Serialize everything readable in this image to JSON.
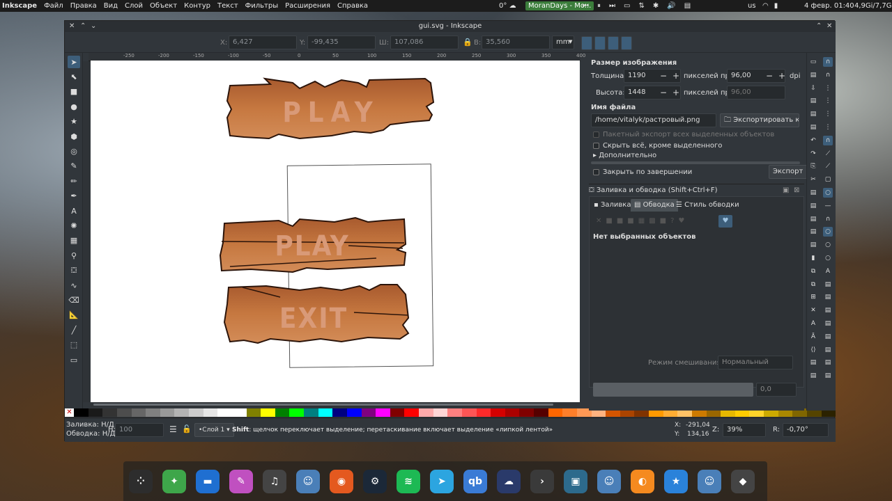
{
  "topbar": {
    "app": "Inkscape",
    "menu": [
      "Файл",
      "Правка",
      "Вид",
      "Слой",
      "Объект",
      "Контур",
      "Текст",
      "Фильтры",
      "Расширения",
      "Справка"
    ],
    "weather": "0°",
    "media": "MoranDays - Mo...",
    "lang": "us",
    "clock": "4 февр. 01:40",
    "mem": "4,9Gi/7,7G"
  },
  "window": {
    "title": "gui.svg - Inkscape"
  },
  "toolbar": {
    "x_label": "X:",
    "x_value": "6,427",
    "y_label": "Y:",
    "y_value": "-99,435",
    "w_label": "Ш:",
    "w_value": "107,086",
    "h_label": "В:",
    "h_value": "35,560",
    "unit": "mm"
  },
  "ruler": {
    "h": [
      "-250",
      "-200",
      "-150",
      "-100",
      "-50",
      "0",
      "50",
      "100",
      "150",
      "200",
      "250",
      "300",
      "350",
      "400",
      "450"
    ]
  },
  "tools": [
    {
      "name": "selector-tool",
      "glyph": "➤",
      "sel": true
    },
    {
      "name": "node-tool",
      "glyph": "⬉"
    },
    {
      "name": "rect-tool",
      "glyph": "■"
    },
    {
      "name": "ellipse-tool",
      "glyph": "●"
    },
    {
      "name": "star-tool",
      "glyph": "★"
    },
    {
      "name": "3dbox-tool",
      "glyph": "⬢"
    },
    {
      "name": "spiral-tool",
      "glyph": "◎"
    },
    {
      "name": "pen-tool",
      "glyph": "✎"
    },
    {
      "name": "pencil-tool",
      "glyph": "✏"
    },
    {
      "name": "calligraphy-tool",
      "glyph": "✒"
    },
    {
      "name": "text-tool",
      "glyph": "A"
    },
    {
      "name": "spray-tool",
      "glyph": "✺"
    },
    {
      "name": "mesh-tool",
      "glyph": "▦"
    },
    {
      "name": "dropper-tool",
      "glyph": "⚲"
    },
    {
      "name": "bucket-tool",
      "glyph": "⛋"
    },
    {
      "name": "tweak-tool",
      "glyph": "∿"
    },
    {
      "name": "eraser-tool",
      "glyph": "⌫"
    },
    {
      "name": "measure-tool",
      "glyph": "📐"
    },
    {
      "name": "connector-tool",
      "glyph": "╱"
    },
    {
      "name": "zoom-tool",
      "glyph": "⬚"
    },
    {
      "name": "page-tool",
      "glyph": "▭"
    }
  ],
  "canvas": {
    "play1": "PLAY",
    "play2": "PLAY",
    "exit": "EXIT"
  },
  "export": {
    "size_title": "Размер изображения",
    "width_label": "Толщина:",
    "width_value": "1190",
    "px_at": "пикселей при",
    "dpi_value": "96,00",
    "dpi": "dpi",
    "height_label": "Высота:",
    "height_value": "1448",
    "px_at2": "пикселей при",
    "dpi_value2": "96,00",
    "filename_title": "Имя файла",
    "filename": "/home/vitalyk/растровый.png",
    "export_as": "Экспортировать как...",
    "batch": "Пакетный экспорт всех выделенных объектов",
    "hide_all": "Скрыть всё, кроме выделенного",
    "advanced": "Дополнительно",
    "close_done": "Закрыть по завершении",
    "export_btn": "Экспорт"
  },
  "fill": {
    "title": "Заливка и обводка (Shift+Ctrl+F)",
    "tabs": [
      "Заливка",
      "Обводка",
      "Стиль обводки"
    ],
    "none": "Нет выбранных объектов",
    "blend_label": "Режим смешивания:",
    "blend_value": "Нормальный",
    "opacity_value": "0,0"
  },
  "status": {
    "fill_label": "Заливка:",
    "fill_value": "Н/Д",
    "stroke_label": "Обводка:",
    "stroke_value": "Н/Д",
    "h_label": "Н:",
    "h_value": "100",
    "layer": "•Слой 1",
    "msg_bold": "Shift",
    "msg": ": щелчок переключает выделение; перетаскивание включает выделение «липкой лентой»",
    "x_label": "X:",
    "x_value": "-291,04",
    "y_label": "Y:",
    "y_value": "134,16",
    "z_label": "Z:",
    "zoom": "39%",
    "r_label": "R:",
    "rotate": "-0,70°"
  },
  "palette": [
    "#000000",
    "#1a1a1a",
    "#333333",
    "#4d4d4d",
    "#666666",
    "#808080",
    "#999999",
    "#b3b3b3",
    "#cccccc",
    "#e6e6e6",
    "#ffffff",
    "#ffffff",
    "#808000",
    "#ffff00",
    "#008000",
    "#00ff00",
    "#008080",
    "#00ffff",
    "#000080",
    "#0000ff",
    "#800080",
    "#ff00ff",
    "#800000",
    "#ff0000",
    "#ffaaaa",
    "#ffd5d5",
    "#ff8080",
    "#ff5555",
    "#ff2a2a",
    "#d40000",
    "#aa0000",
    "#800000",
    "#550000",
    "#ff6600",
    "#ff7f2a",
    "#ff9955",
    "#ffb380",
    "#d45500",
    "#aa4400",
    "#803300",
    "#ff9900",
    "#ffad33",
    "#ffc266",
    "#cc7a00",
    "#996600",
    "#e6b800",
    "#ffcc00",
    "#ffd42a",
    "#ccaa00",
    "#aa8800",
    "#806600",
    "#554400",
    "#2b2200"
  ],
  "dock": [
    {
      "name": "launcher-icon",
      "bg": "#2d2d2d",
      "g": "⁘"
    },
    {
      "name": "android-icon",
      "bg": "#3ea64a",
      "g": "✦"
    },
    {
      "name": "files-icon",
      "bg": "#1f6fd1",
      "g": "▬"
    },
    {
      "name": "gimp-icon",
      "bg": "#c050c0",
      "g": "✎"
    },
    {
      "name": "audio-blender-icon",
      "bg": "#444",
      "g": "♫"
    },
    {
      "name": "godot-icon",
      "bg": "#4a7fb8",
      "g": "☺"
    },
    {
      "name": "firefox-icon",
      "bg": "#e4591f",
      "g": "◉"
    },
    {
      "name": "steam-icon",
      "bg": "#1b2838",
      "g": "⚙"
    },
    {
      "name": "spotify-icon",
      "bg": "#1db954",
      "g": "≋"
    },
    {
      "name": "telegram-icon",
      "bg": "#2ca5e0",
      "g": "➤"
    },
    {
      "name": "qbittorrent-icon",
      "bg": "#3a7bd5",
      "g": "qb"
    },
    {
      "name": "cloud-icon",
      "bg": "#2a3a6a",
      "g": "☁"
    },
    {
      "name": "terminal-icon",
      "bg": "#3a3a3a",
      "g": "›"
    },
    {
      "name": "monitor-icon",
      "bg": "#2d6a8c",
      "g": "▣"
    },
    {
      "name": "godot2-icon",
      "bg": "#4a7fb8",
      "g": "☺"
    },
    {
      "name": "blender-icon",
      "bg": "#f58a1f",
      "g": "◐"
    },
    {
      "name": "kde-star-icon",
      "bg": "#2a82da",
      "g": "★"
    },
    {
      "name": "godot3-icon",
      "bg": "#4a7fb8",
      "g": "☺"
    },
    {
      "name": "inkscape-icon",
      "bg": "#444",
      "g": "◆"
    }
  ]
}
